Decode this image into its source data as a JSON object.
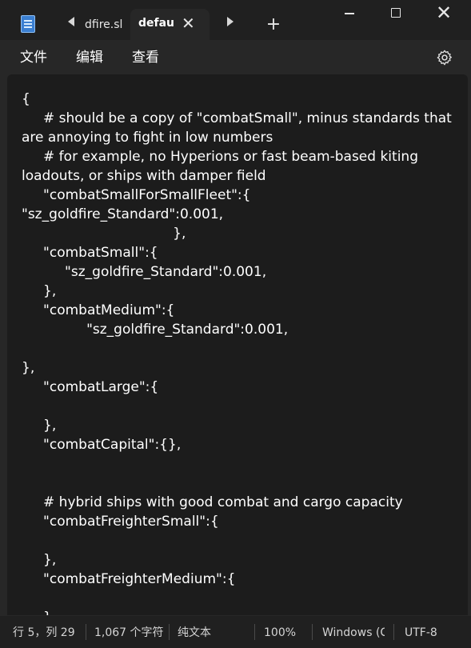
{
  "titlebar": {
    "app_icon": "notepad-icon",
    "tabs": [
      {
        "label": "dfire.sl",
        "active": false
      },
      {
        "label": "defau",
        "active": true
      }
    ],
    "icons": {
      "scroll_left": "chevron-left-icon",
      "scroll_right": "chevron-right-icon",
      "tab_close": "close-icon",
      "new_tab": "plus-icon",
      "minimize": "minimize-icon",
      "maximize": "maximize-icon",
      "close": "close-icon"
    },
    "tab_close_glyph": "✕",
    "new_tab_glyph": "+",
    "window_close_glyph": "✕"
  },
  "menu": {
    "items": [
      "文件",
      "编辑",
      "查看"
    ],
    "settings_icon": "gear-icon"
  },
  "editor": {
    "text": "{\n\t# should be a copy of \"combatSmall\", minus standards that are annoying to fight in low numbers\n\t# for example, no Hyperions or fast beam-based kiting loadouts, or ships with damper field\n\t\"combatSmallForSmallFleet\":{\n\"sz_goldfire_Standard\":0.001,\n\t\t\t\t\t\t\t},\n\t\"combatSmall\":{\n\t\t\"sz_goldfire_Standard\":0.001,\n\t},\n\t\"combatMedium\":{\n\t\t\t\"sz_goldfire_Standard\":0.001,\n\n},\n\t\"combatLarge\":{\n\n\t},\n\t\"combatCapital\":{},\n\n\n\t# hybrid ships with good combat and cargo capacity\n\t\"combatFreighterSmall\":{\n\n\t},\n\t\"combatFreighterMedium\":{\n\n\t},"
  },
  "status": {
    "position": "行 5，列 29",
    "char_count": "1,067 个字符",
    "format": "纯文本",
    "zoom": "100%",
    "line_ending": "Windows (C",
    "encoding": "UTF-8"
  },
  "colors": {
    "titlebar_bg": "#202020",
    "editor_bg": "#1c1c1c",
    "menubar_bg": "#272727",
    "text": "#ffffff"
  }
}
